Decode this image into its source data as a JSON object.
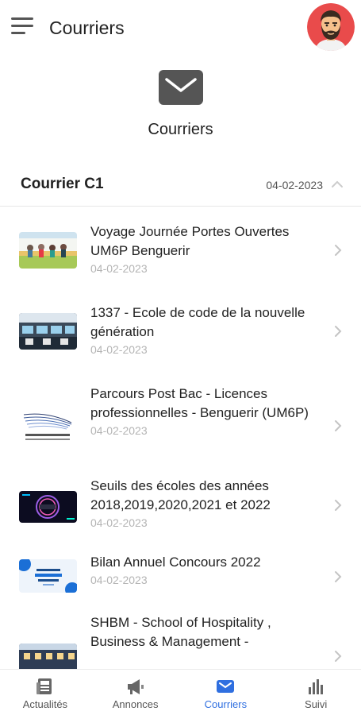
{
  "header": {
    "title": "Courriers",
    "menu_icon": "hamburger-menu-icon",
    "avatar_icon": "bearded-man-avatar"
  },
  "hero": {
    "title": "Courriers",
    "icon": "envelope-icon"
  },
  "section": {
    "title": "Courrier C1",
    "date": "04-02-2023",
    "expanded": true
  },
  "items": [
    {
      "title": "Voyage Journée Portes Ouvertes UM6P Benguerir",
      "date": "04-02-2023",
      "thumb": "photo-group-outdoors"
    },
    {
      "title": "1337 - Ecole de code de la nouvelle génération",
      "date": "04-02-2023",
      "thumb": "photo-computer-lab"
    },
    {
      "title": "Parcours Post Bac - Licences professionnelles - Benguerir (UM6P)",
      "date": "04-02-2023",
      "thumb": "university-logo"
    },
    {
      "title": "Seuils des écoles des années 2018,2019,2020,2021 et 2022",
      "date": "04-02-2023",
      "thumb": "dark-neon-banner"
    },
    {
      "title": "Bilan Annuel Concours 2022",
      "date": "04-02-2023",
      "thumb": "blue-white-banner"
    },
    {
      "title": "SHBM - School of Hospitality , Business & Management -",
      "date": "",
      "thumb": "photo-building"
    }
  ],
  "nav": {
    "items": [
      {
        "label": "Actualités",
        "icon": "newspaper-icon",
        "active": false
      },
      {
        "label": "Annonces",
        "icon": "megaphone-icon",
        "active": false
      },
      {
        "label": "Courriers",
        "icon": "envelope-icon",
        "active": true
      },
      {
        "label": "Suivi",
        "icon": "bar-chart-icon",
        "active": false
      }
    ]
  },
  "colors": {
    "accent": "#2f6fe0",
    "text": "#222222",
    "muted": "#b4b4b4",
    "envelope": "#555555"
  }
}
